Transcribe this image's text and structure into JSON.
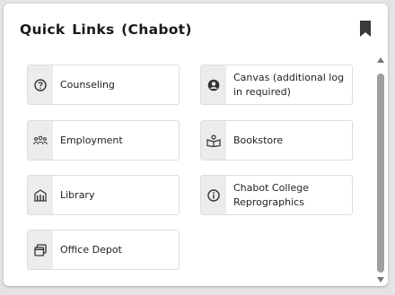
{
  "widget": {
    "title": "Quick Links (Chabot)",
    "bookmark_icon": "bookmark-icon"
  },
  "links": [
    {
      "label": "Counseling",
      "icon": "question-circle-icon"
    },
    {
      "label": "Canvas (additional log in required)",
      "icon": "user-circle-icon"
    },
    {
      "label": "Employment",
      "icon": "people-group-icon"
    },
    {
      "label": "Bookstore",
      "icon": "open-book-icon"
    },
    {
      "label": "Library",
      "icon": "library-building-icon"
    },
    {
      "label": "Chabot College Reprographics",
      "icon": "info-circle-icon"
    },
    {
      "label": "Office Depot",
      "icon": "windows-stack-icon"
    }
  ],
  "colors": {
    "icon_box": "#ececec",
    "border": "#dcdcdc",
    "scrollbar": "#9e9e9e"
  }
}
